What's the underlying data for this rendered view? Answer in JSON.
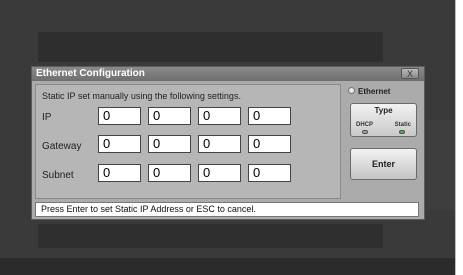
{
  "dialog": {
    "title": "Ethernet Configuration",
    "close_label": "X",
    "instruction": "Static IP set manually using the following settings.",
    "rows": [
      {
        "label": "IP",
        "octets": [
          "0",
          "0",
          "0",
          "0"
        ]
      },
      {
        "label": "Gateway",
        "octets": [
          "0",
          "0",
          "0",
          "0"
        ]
      },
      {
        "label": "Subnet",
        "octets": [
          "0",
          "0",
          "0",
          "0"
        ]
      }
    ],
    "side": {
      "ethernet_label": "Ethernet",
      "type_label": "Type",
      "dhcp_label": "DHCP",
      "static_label": "Static",
      "enter_label": "Enter"
    },
    "status_text": "Press Enter to set Static IP Address or ESC to cancel."
  },
  "colors": {
    "static_led": "#4caf50",
    "dhcp_led": "#9e9e9e"
  }
}
